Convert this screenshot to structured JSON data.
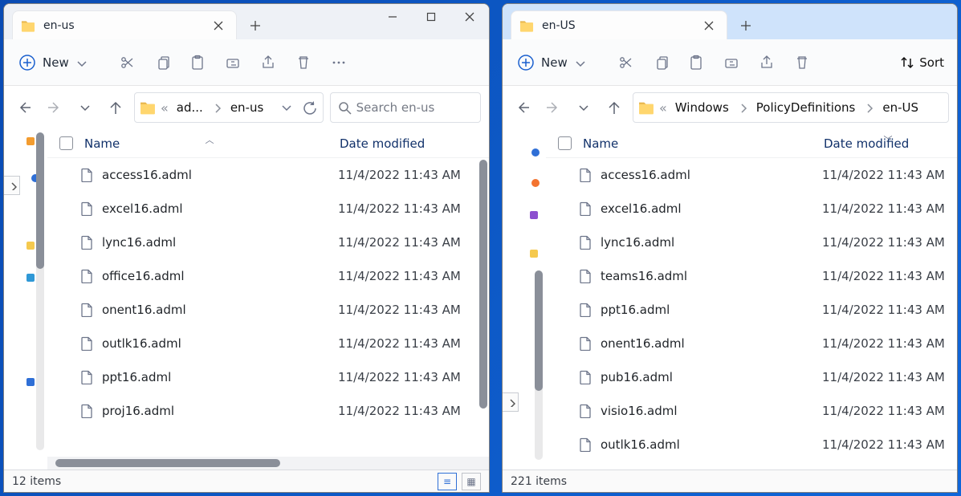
{
  "left": {
    "tab_title": "en-us",
    "new_label": "New",
    "search_placeholder": "Search en-us",
    "breadcrumbs": [
      "ad...",
      "en-us"
    ],
    "columns": {
      "name": "Name",
      "date": "Date modified"
    },
    "sort_direction": "asc",
    "files": [
      {
        "name": "access16.adml",
        "date": "11/4/2022 11:43 AM"
      },
      {
        "name": "excel16.adml",
        "date": "11/4/2022 11:43 AM"
      },
      {
        "name": "lync16.adml",
        "date": "11/4/2022 11:43 AM"
      },
      {
        "name": "office16.adml",
        "date": "11/4/2022 11:43 AM"
      },
      {
        "name": "onent16.adml",
        "date": "11/4/2022 11:43 AM"
      },
      {
        "name": "outlk16.adml",
        "date": "11/4/2022 11:43 AM"
      },
      {
        "name": "ppt16.adml",
        "date": "11/4/2022 11:43 AM"
      },
      {
        "name": "proj16.adml",
        "date": "11/4/2022 11:43 AM"
      }
    ],
    "status": "12 items"
  },
  "right": {
    "tab_title": "en-US",
    "tabbar_bg": "#cfe3fb",
    "new_label": "New",
    "sort_label": "Sort",
    "breadcrumbs": [
      "Windows",
      "PolicyDefinitions",
      "en-US"
    ],
    "columns": {
      "name": "Name",
      "date": "Date modified"
    },
    "files": [
      {
        "name": "access16.adml",
        "date": "11/4/2022 11:43 AM"
      },
      {
        "name": "excel16.adml",
        "date": "11/4/2022 11:43 AM"
      },
      {
        "name": "lync16.adml",
        "date": "11/4/2022 11:43 AM"
      },
      {
        "name": "teams16.adml",
        "date": "11/4/2022 11:43 AM"
      },
      {
        "name": "ppt16.adml",
        "date": "11/4/2022 11:43 AM"
      },
      {
        "name": "onent16.adml",
        "date": "11/4/2022 11:43 AM"
      },
      {
        "name": "pub16.adml",
        "date": "11/4/2022 11:43 AM"
      },
      {
        "name": "visio16.adml",
        "date": "11/4/2022 11:43 AM"
      },
      {
        "name": "outlk16.adml",
        "date": "11/4/2022 11:43 AM"
      }
    ],
    "status": "221 items"
  }
}
